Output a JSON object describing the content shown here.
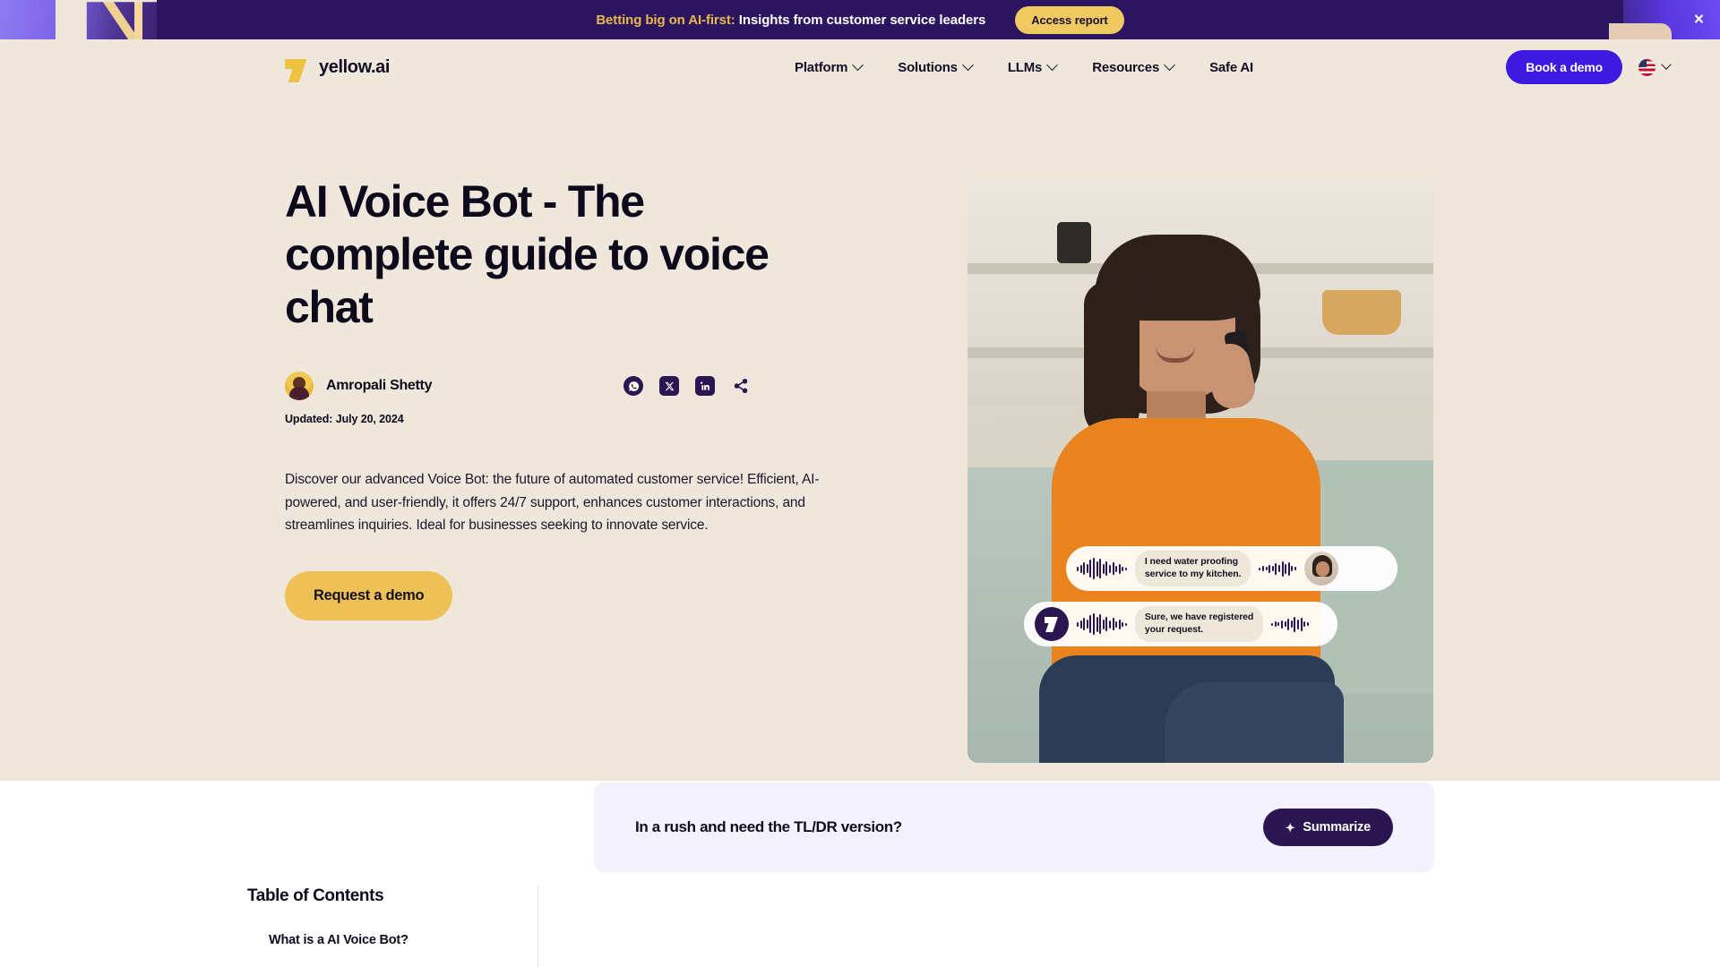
{
  "banner": {
    "highlight": "Betting big on AI-first:",
    "text": " Insights from customer service leaders",
    "cta": "Access report",
    "close_icon": "×"
  },
  "nav": {
    "brand": "yellow.ai",
    "items": [
      {
        "label": "Platform",
        "has_chevron": true
      },
      {
        "label": "Solutions",
        "has_chevron": true
      },
      {
        "label": "LLMs",
        "has_chevron": true
      },
      {
        "label": "Resources",
        "has_chevron": true
      },
      {
        "label": "Safe AI",
        "has_chevron": false
      }
    ],
    "book_demo": "Book a demo"
  },
  "hero": {
    "title": "AI Voice Bot - The complete guide to voice chat",
    "author": "Amropali Shetty",
    "updated": "Updated: July 20, 2024",
    "description": "Discover our advanced Voice Bot: the future of automated customer service! Efficient, AI-powered, and user-friendly, it offers 24/7 support, enhances customer interactions, and streamlines inquiries. Ideal for businesses seeking to innovate service.",
    "cta": "Request a demo",
    "socials": [
      "whatsapp-icon",
      "x-twitter-icon",
      "linkedin-icon",
      "share-icon"
    ],
    "chat": [
      {
        "message": "I need water proofing\nservice to my kitchen.",
        "speaker": "user"
      },
      {
        "message": "Sure, we have registered\nyour request.",
        "speaker": "bot"
      }
    ]
  },
  "bottom": {
    "toc_title": "Table of Contents",
    "toc_items": [
      "What is a AI Voice Bot?"
    ],
    "tldr_text": "In a rush and need the TL/DR version?",
    "summarize": "Summarize",
    "sparkle_icon": "✦"
  },
  "colors": {
    "banner_bg": "#2b1560",
    "hero_bg": "#efe7db",
    "accent_gold": "#edc155",
    "accent_purple": "#3d1ae0",
    "dark_purple": "#2b1652",
    "tldr_bg": "#f4f2ff"
  }
}
